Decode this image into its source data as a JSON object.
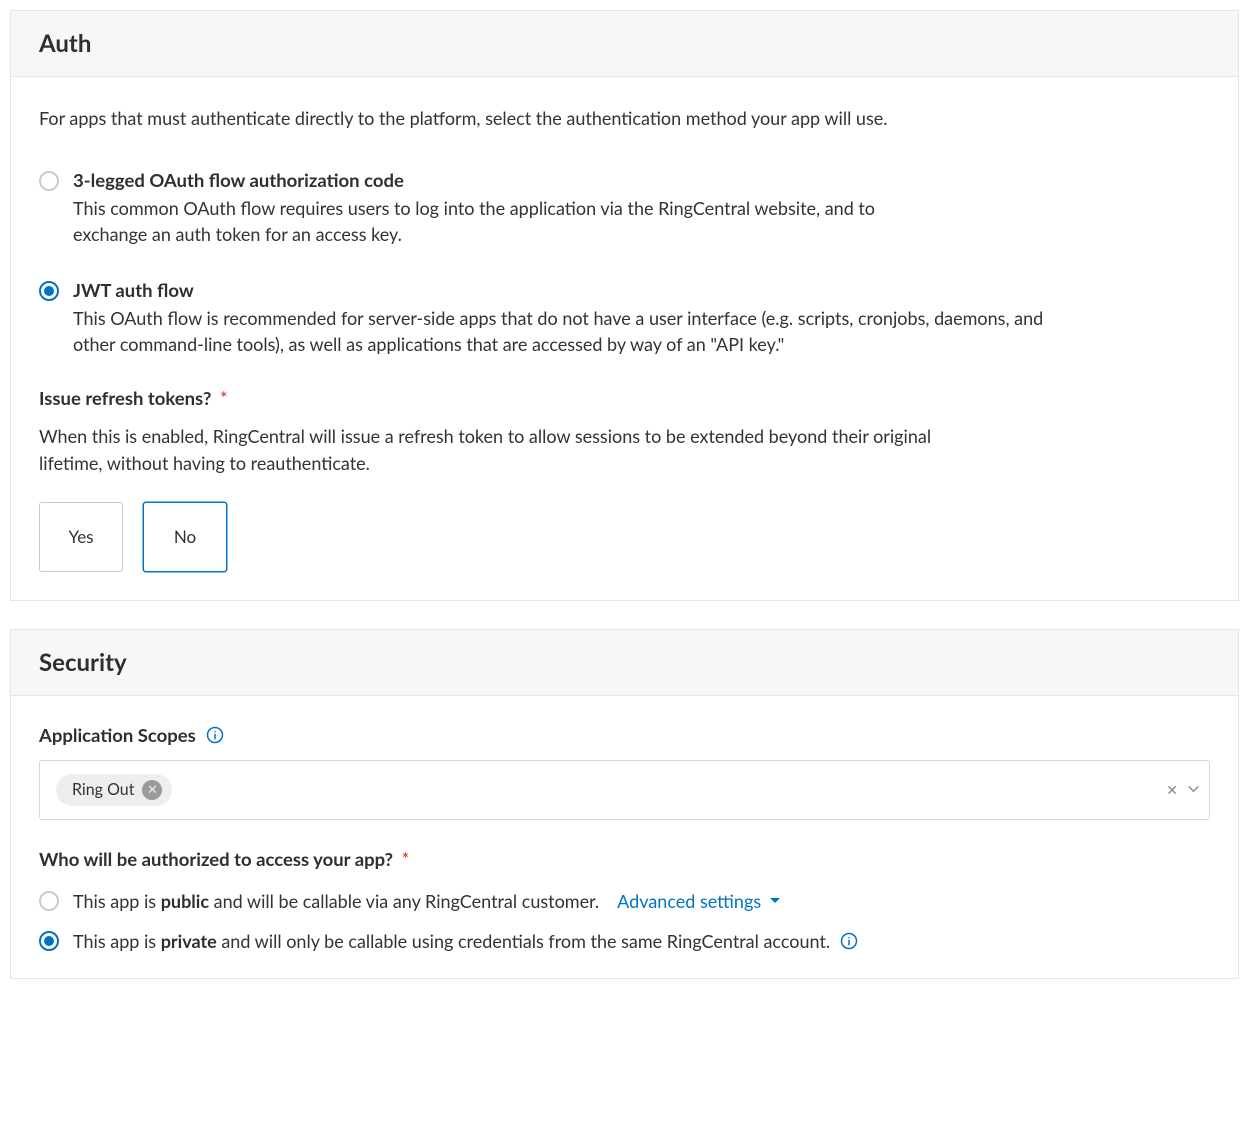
{
  "auth": {
    "heading": "Auth",
    "intro": "For apps that must authenticate directly to the platform, select the authentication method your app will use.",
    "options": [
      {
        "title": "3-legged OAuth flow authorization code",
        "desc": "This common OAuth flow requires users to log into the application via the RingCentral website, and to exchange an auth token for an access key.",
        "selected": false
      },
      {
        "title": "JWT auth flow",
        "desc": "This OAuth flow is recommended for server-side apps that do not have a user interface (e.g. scripts, cronjobs, daemons, and other command-line tools), as well as applications that are accessed by way of an \"API key.\"",
        "selected": true
      }
    ],
    "refresh_question": "Issue refresh tokens?",
    "refresh_desc": "When this is enabled, RingCentral will issue a refresh token to allow sessions to be extended beyond their original lifetime, without having to reauthenticate.",
    "yes_label": "Yes",
    "no_label": "No",
    "refresh_selected": "No"
  },
  "security": {
    "heading": "Security",
    "scopes_label": "Application Scopes",
    "scopes_selected": [
      {
        "label": "Ring Out"
      }
    ],
    "access_question": "Who will be authorized to access your app?",
    "access_options": [
      {
        "prefix": "This app is ",
        "strong": "public",
        "suffix": " and will be callable via any RingCentral customer.",
        "selected": false,
        "advanced": true
      },
      {
        "prefix": "This app is ",
        "strong": "private",
        "suffix": " and will only be callable using credentials from the same RingCentral account.",
        "selected": true,
        "info": true
      }
    ],
    "advanced_label": "Advanced settings"
  }
}
